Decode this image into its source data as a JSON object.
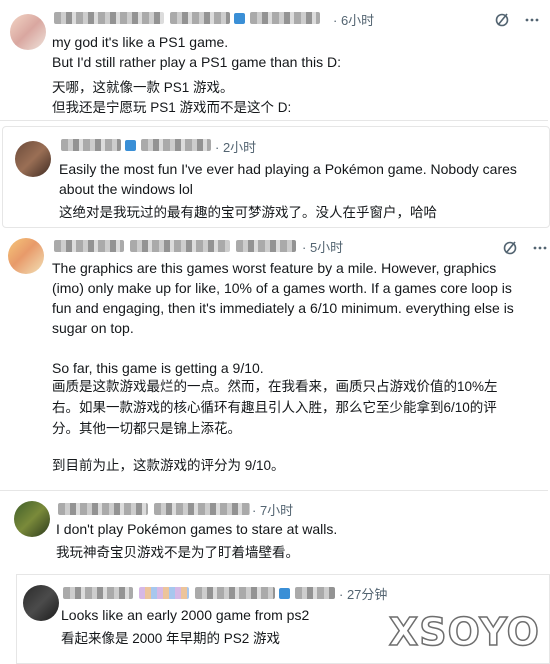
{
  "comments": [
    {
      "time": "6小时",
      "lines_en": [
        "my god it's like a PS1 game.",
        "But I'd still rather play a PS1 game than this D:"
      ],
      "lines_zh": [
        "天哪，这就像一款 PS1 游戏。",
        "但我还是宁愿玩 PS1 游戏而不是这个 D:"
      ]
    },
    {
      "time": "2小时",
      "lines_en": [
        "Easily the most fun I've ever had playing a Pokémon game. Nobody cares",
        "about the windows lol"
      ],
      "lines_zh": [
        "这绝对是我玩过的最有趣的宝可梦游戏了。没人在乎窗户，哈哈"
      ]
    },
    {
      "time": "5小时",
      "lines_en": [
        "The graphics are this games worst feature by a mile. However, graphics",
        "(imo) only make up for like, 10% of a games worth. If a games core loop is",
        "fun and engaging, then it's immediately a 6/10 minimum. everything else is",
        "sugar on top.",
        "",
        "So far, this game is getting a 9/10."
      ],
      "lines_zh": [
        "画质是这款游戏最烂的一点。然而，在我看来，画质只占游戏价值的10%左",
        "右。如果一款游戏的核心循环有趣且引人入胜，那么它至少能拿到6/10的评",
        "分。其他一切都只是锦上添花。",
        "",
        "到目前为止，这款游戏的评分为 9/10。"
      ]
    },
    {
      "time": "7小时",
      "lines_en": [
        "I don't play Pokémon games to stare at walls."
      ],
      "lines_zh": [
        "我玩神奇宝贝游戏不是为了盯着墙壁看。"
      ]
    },
    {
      "time": "27分钟",
      "lines_en": [
        "Looks like an early 2000 game from ps2"
      ],
      "lines_zh": [
        "看起来像是 2000 年早期的 PS2 游戏"
      ]
    }
  ],
  "icons": {
    "grok": "grok-icon",
    "more": "more-icon"
  },
  "watermark": "XSOYO"
}
